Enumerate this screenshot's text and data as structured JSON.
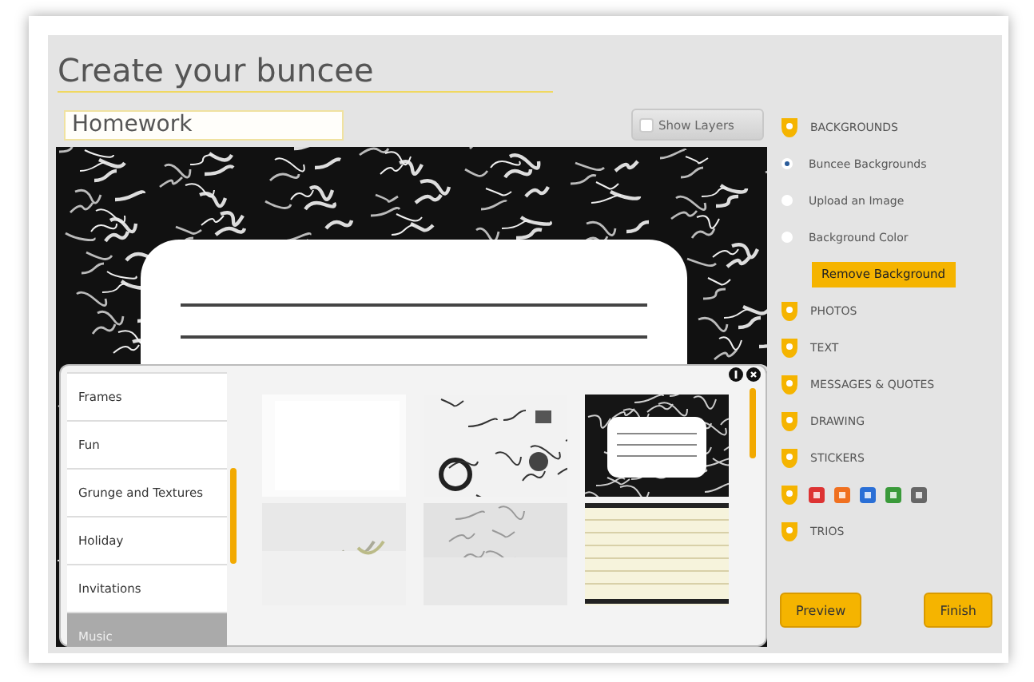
{
  "header": {
    "title": "Create your buncee"
  },
  "editor": {
    "title_field": {
      "value": "Homework"
    },
    "show_layers": {
      "label": "Show Layers",
      "checked": false
    }
  },
  "picker": {
    "categories": [
      {
        "label": "Frames",
        "selected": false
      },
      {
        "label": "Fun",
        "selected": false
      },
      {
        "label": "Grunge and Textures",
        "selected": false
      },
      {
        "label": "Holiday",
        "selected": false
      },
      {
        "label": "Invitations",
        "selected": false
      },
      {
        "label": "Music",
        "selected": true
      }
    ]
  },
  "sidebar": {
    "items": [
      {
        "kind": "section",
        "label": "BACKGROUNDS"
      },
      {
        "kind": "radio",
        "label": "Buncee Backgrounds",
        "selected": true
      },
      {
        "kind": "radio",
        "label": "Upload an Image",
        "selected": false
      },
      {
        "kind": "radio",
        "label": "Background Color",
        "selected": false
      },
      {
        "kind": "button",
        "label": "Remove Background"
      },
      {
        "kind": "section",
        "label": "PHOTOS"
      },
      {
        "kind": "section",
        "label": "TEXT"
      },
      {
        "kind": "section",
        "label": "MESSAGES & QUOTES"
      },
      {
        "kind": "section",
        "label": "DRAWING"
      },
      {
        "kind": "section",
        "label": "STICKERS"
      },
      {
        "kind": "social"
      },
      {
        "kind": "section",
        "label": "TRIOS"
      }
    ]
  },
  "actions": [
    {
      "label": "Preview"
    },
    {
      "label": "Finish"
    }
  ]
}
